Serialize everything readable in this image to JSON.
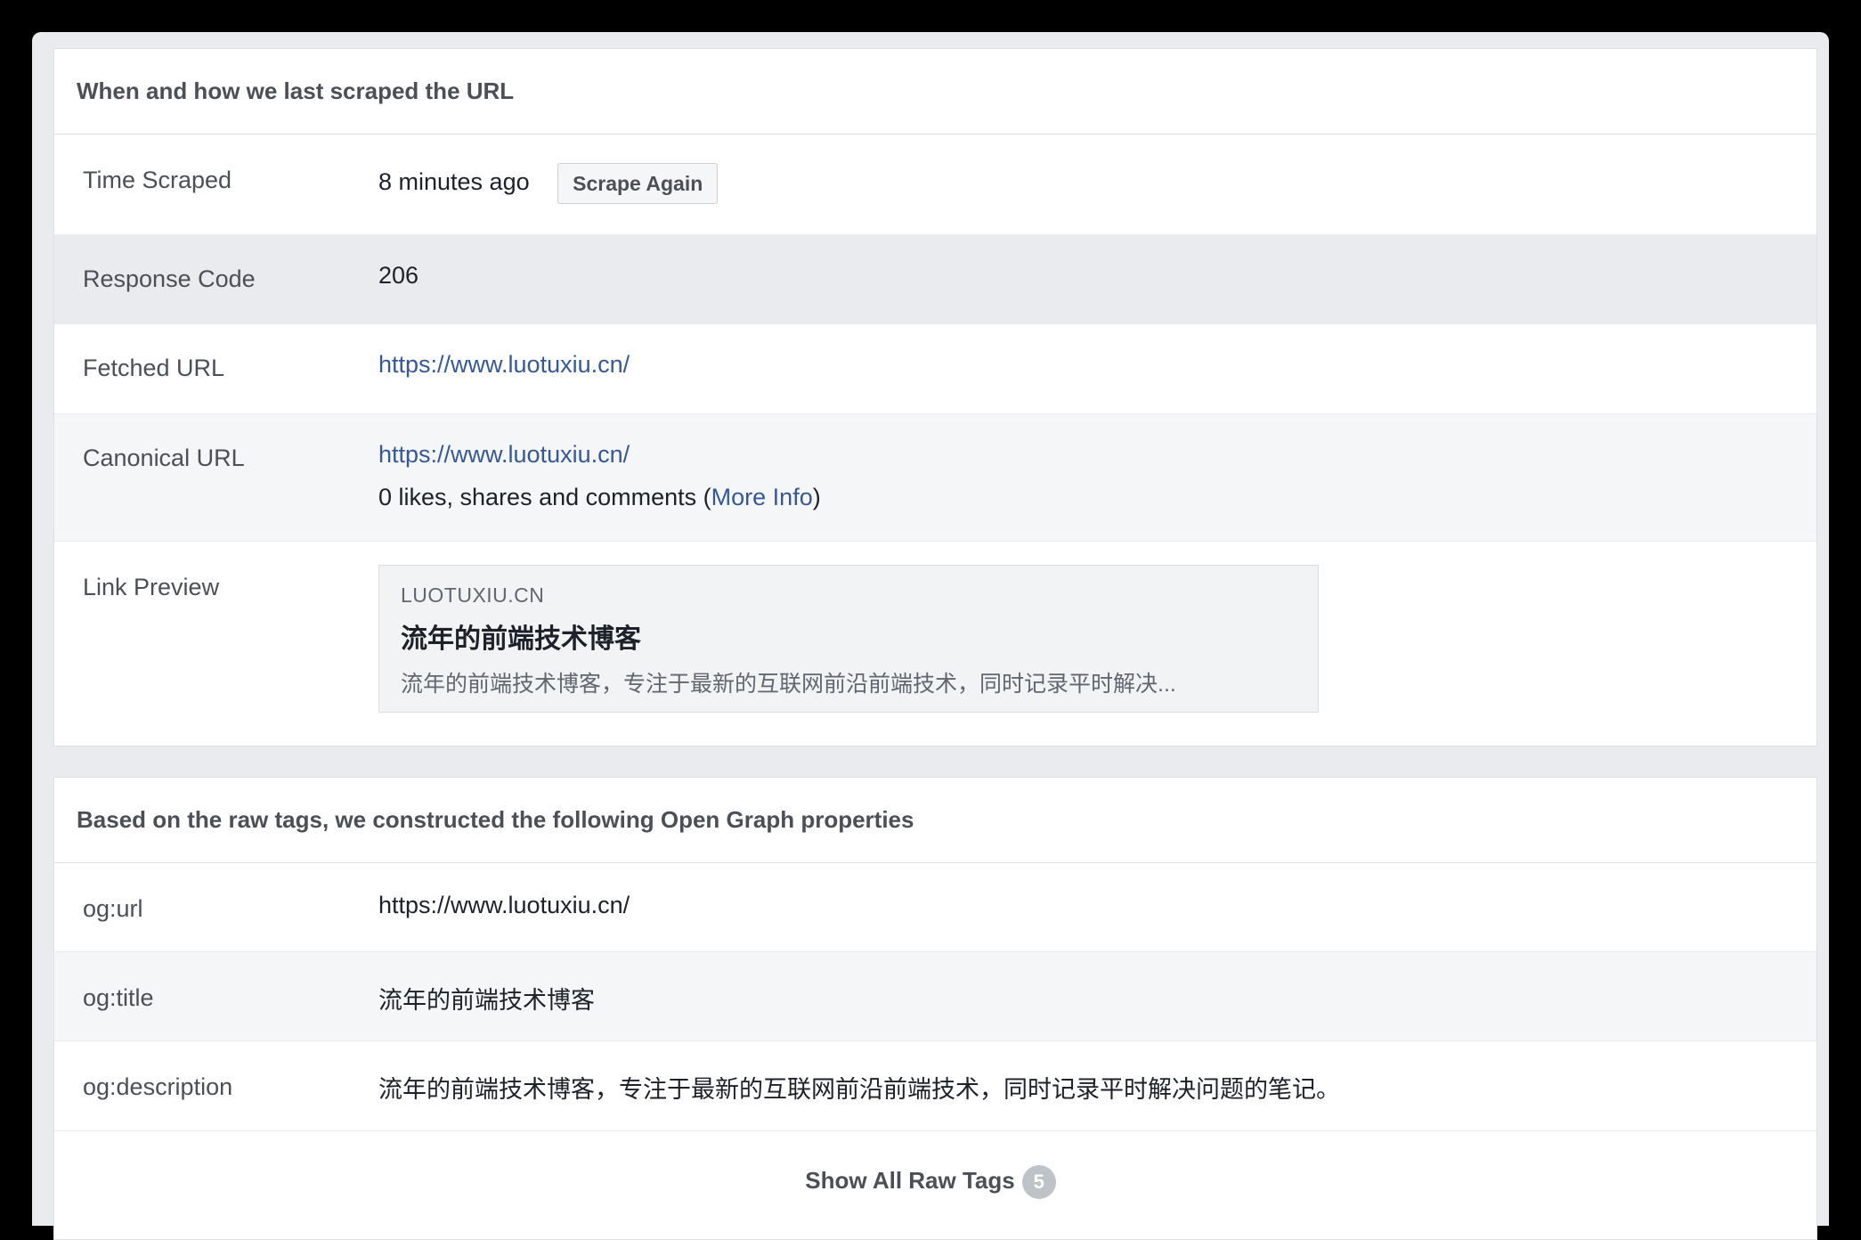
{
  "scrape_panel": {
    "heading": "When and how we last scraped the URL",
    "time_scraped": {
      "label": "Time Scraped",
      "value": "8 minutes ago",
      "button": "Scrape Again"
    },
    "response_code": {
      "label": "Response Code",
      "value": "206"
    },
    "fetched_url": {
      "label": "Fetched URL",
      "value": "https://www.luotuxiu.cn/"
    },
    "canonical_url": {
      "label": "Canonical URL",
      "value": "https://www.luotuxiu.cn/",
      "engagement_prefix": "0 likes, shares and comments (",
      "more_info": "More Info",
      "engagement_suffix": ")"
    },
    "link_preview": {
      "label": "Link Preview",
      "domain": "LUOTUXIU.CN",
      "title": "流年的前端技术博客",
      "description": "流年的前端技术博客，专注于最新的互联网前沿前端技术，同时记录平时解决..."
    }
  },
  "og_panel": {
    "heading": "Based on the raw tags, we constructed the following Open Graph properties",
    "rows": [
      {
        "label": "og:url",
        "value": "https://www.luotuxiu.cn/"
      },
      {
        "label": "og:title",
        "value": "流年的前端技术博客"
      },
      {
        "label": "og:description",
        "value": "流年的前端技术博客，专注于最新的互联网前沿前端技术，同时记录平时解决问题的笔记。"
      }
    ],
    "show_all": {
      "label": "Show All Raw Tags",
      "count": "5"
    }
  }
}
